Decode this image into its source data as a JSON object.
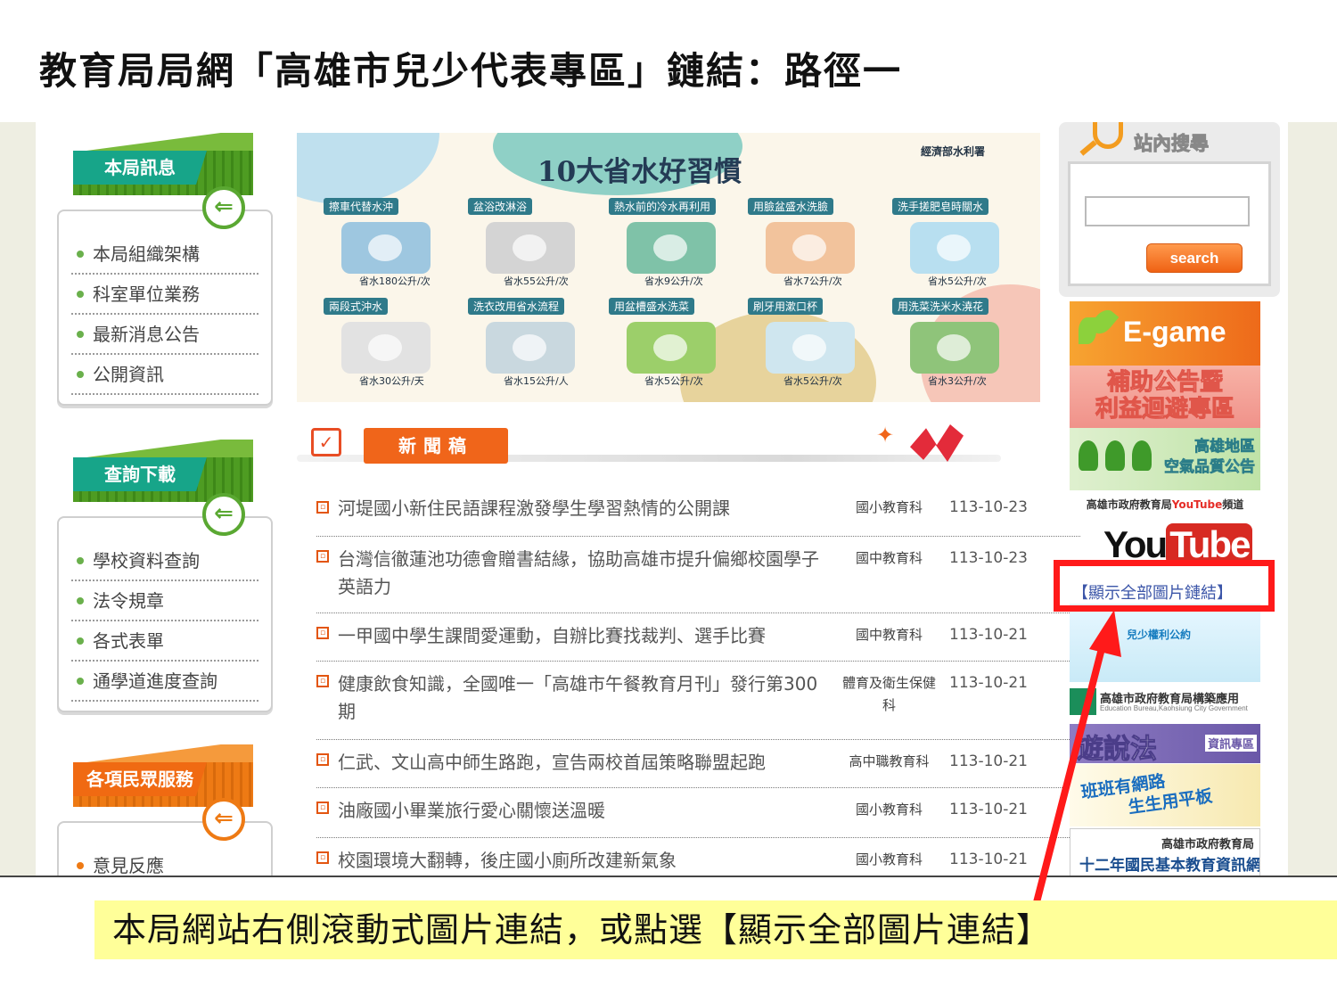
{
  "slide": {
    "title": "教育局局網「高雄市兒少代表專區」鏈結：路徑一",
    "caption": "本局網站右側滾動式圖片連結，或點選【顯示全部圖片連結】"
  },
  "left_menus": [
    {
      "title": "本局訊息",
      "arrow": "⇐",
      "items": [
        "本局組織架構",
        "科室單位業務",
        "最新消息公告",
        "公開資訊"
      ]
    },
    {
      "title": "查詢下載",
      "arrow": "⇐",
      "items": [
        "學校資料查詢",
        "法令規章",
        "各式表單",
        "通學道進度查詢"
      ]
    },
    {
      "title": "各項民眾服務",
      "arrow": "⇐",
      "items": [
        "意見反應"
      ]
    }
  ],
  "banner": {
    "title": "10大省水好習慣",
    "logo": "經濟部水利署",
    "tips": [
      {
        "label": "擦車代替水沖",
        "save": "省水180公升/次"
      },
      {
        "label": "盆浴改淋浴",
        "save": "省水55公升/次"
      },
      {
        "label": "熱水前的冷水再利用",
        "save": "省水9公升/次"
      },
      {
        "label": "用臉盆盛水洗臉",
        "save": "省水7公升/次"
      },
      {
        "label": "洗手搓肥皂時關水",
        "save": "省水5公升/次"
      },
      {
        "label": "兩段式沖水",
        "save": "省水30公升/天"
      },
      {
        "label": "洗衣改用省水流程",
        "save": "省水15公升/人"
      },
      {
        "label": "用盆槽盛水洗菜",
        "save": "省水5公升/次"
      },
      {
        "label": "刷牙用漱口杯",
        "save": "省水5公升/次"
      },
      {
        "label": "用洗菜洗米水澆花",
        "save": "省水3公升/次"
      }
    ]
  },
  "news": {
    "badge": "新聞稿",
    "rows": [
      {
        "title": "河堤國小新住民語課程激發學生學習熱情的公開課",
        "unit": "國小教育科",
        "date": "113-10-23"
      },
      {
        "title": "台灣信徹蓮池功德會贈書結緣，協助高雄市提升偏鄉校園學子英語力",
        "unit": "國中教育科",
        "date": "113-10-23"
      },
      {
        "title": "一甲國中學生課間愛運動，自辦比賽找裁判、選手比賽",
        "unit": "國中教育科",
        "date": "113-10-21"
      },
      {
        "title": "健康飲食知識，全國唯一「高雄市午餐教育月刊」發行第300期",
        "unit": "體育及衛生保健科",
        "date": "113-10-21"
      },
      {
        "title": "仁武、文山高中師生路跑，宣告兩校首屆策略聯盟起跑",
        "unit": "高中職教育科",
        "date": "113-10-21"
      },
      {
        "title": "油廠國小畢業旅行愛心關懷送溫暖",
        "unit": "國小教育科",
        "date": "113-10-21"
      },
      {
        "title": "校園環境大翻轉，後庄國小廁所改建新氣象",
        "unit": "國小教育科",
        "date": "113-10-21"
      }
    ]
  },
  "search": {
    "title": "站內搜尋",
    "button": "search",
    "value": ""
  },
  "right_banners": {
    "egame": "E-game",
    "subsidy_l1": "補助公告暨",
    "subsidy_l2": "利益迴避專區",
    "air_l1": "高雄地區",
    "air_l2": "空氣品質公告",
    "youtube_caption_a": "高雄市政府教育局",
    "youtube_caption_b": "YouTube",
    "youtube_caption_c": "頻道",
    "youtube_you": "You",
    "youtube_tube": "Tube",
    "show_all": "【顯示全部圖片鏈結】",
    "rights": "兒少權利公約",
    "edu_app": "高雄市政府教育局構築應用",
    "edu_app_sub": "Education Bureau,Kaohsiung City Government",
    "speak_big": "遊說法",
    "speak_small": "資訊專區",
    "tablet_l1": "班班有網路",
    "tablet_l2": "生生用平板",
    "plan_l1": "高雄市政府教育局",
    "plan_l2": "十二年國民基本教育資訊網"
  },
  "colors": {
    "highlight": "#ff1a1a",
    "caption_bg": "#ffff99",
    "menu_green": "#4e9c22",
    "menu_orange": "#ee7a14",
    "news_orange": "#f0651a"
  }
}
